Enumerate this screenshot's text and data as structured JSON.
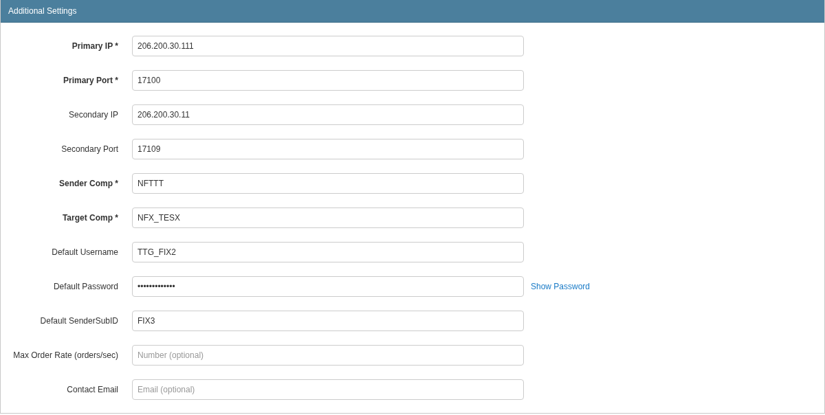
{
  "panel": {
    "title": "Additional Settings"
  },
  "fields": [
    {
      "label": "Primary IP *",
      "required": true,
      "value": "206.200.30.111"
    },
    {
      "label": "Primary Port *",
      "required": true,
      "value": "17100"
    },
    {
      "label": "Secondary IP",
      "required": false,
      "value": "206.200.30.11"
    },
    {
      "label": "Secondary Port",
      "required": false,
      "value": "17109"
    },
    {
      "label": "Sender Comp *",
      "required": true,
      "value": "NFTTT"
    },
    {
      "label": "Target Comp *",
      "required": true,
      "value": "NFX_TESX"
    },
    {
      "label": "Default Username",
      "required": false,
      "value": "TTG_FIX2"
    },
    {
      "label": "Default Password",
      "required": false,
      "value": "•••••••••••••",
      "link": "Show Password"
    },
    {
      "label": "Default SenderSubID",
      "required": false,
      "value": "FIX3"
    },
    {
      "label": "Max Order Rate (orders/sec)",
      "required": false,
      "placeholder": "Number (optional)"
    },
    {
      "label": "Contact Email",
      "required": false,
      "placeholder": "Email (optional)"
    }
  ]
}
